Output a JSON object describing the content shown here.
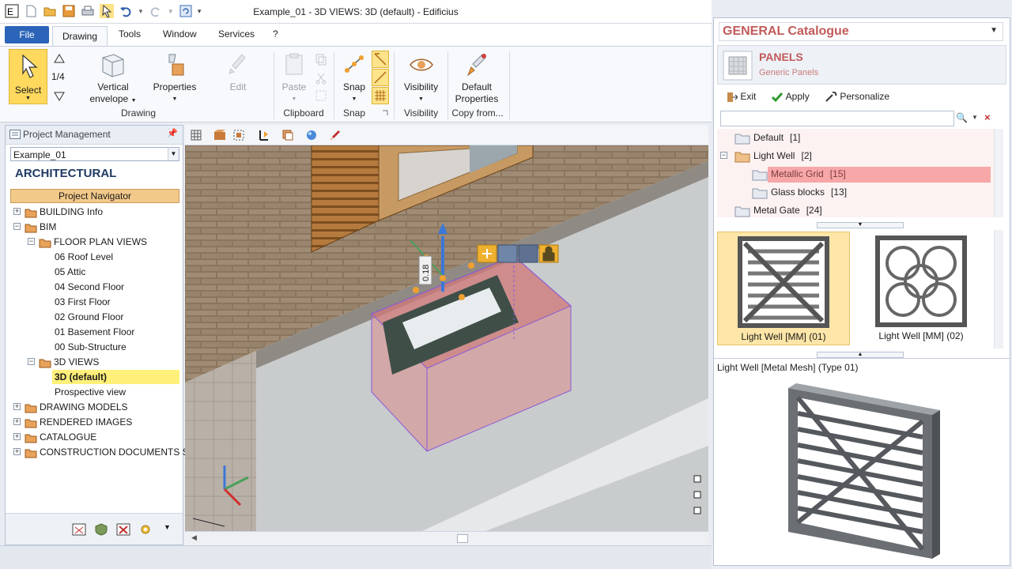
{
  "window": {
    "title": "Example_01 - 3D VIEWS: 3D (default) - Edificius"
  },
  "menu": {
    "file": "File",
    "tabs": [
      "Drawing",
      "Tools",
      "Window",
      "Services",
      "?"
    ]
  },
  "ribbon": {
    "select": "Select",
    "fraction": "1/4",
    "vertical_envelope": [
      "Vertical",
      "envelope"
    ],
    "properties": "Properties",
    "edit": "Edit",
    "paste": "Paste",
    "snap": "Snap",
    "visibility": "Visibility",
    "default_properties": [
      "Default",
      "Properties"
    ],
    "groups": {
      "drawing": "Drawing",
      "clipboard": "Clipboard",
      "snap": "Snap",
      "visibility": "Visibility",
      "copy_from": "Copy from..."
    }
  },
  "left_panel": {
    "header": "Project Management",
    "project": "Example_01",
    "category": "ARCHITECTURAL",
    "navigator": "Project Navigator",
    "tree": [
      {
        "label": "BUILDING Info",
        "level": 0,
        "expander": "+"
      },
      {
        "label": "BIM",
        "level": 0,
        "expander": "−"
      },
      {
        "label": "FLOOR PLAN VIEWS",
        "level": 1,
        "expander": "−"
      },
      {
        "label": "06 Roof Level",
        "level": 2
      },
      {
        "label": "05 Attic",
        "level": 2
      },
      {
        "label": "04 Second Floor",
        "level": 2
      },
      {
        "label": "03 First Floor",
        "level": 2
      },
      {
        "label": "02 Ground Floor",
        "level": 2
      },
      {
        "label": "01 Basement Floor",
        "level": 2
      },
      {
        "label": "00 Sub-Structure",
        "level": 2
      },
      {
        "label": "3D VIEWS",
        "level": 1,
        "expander": "−"
      },
      {
        "label": "3D (default)",
        "level": 2,
        "selected": true
      },
      {
        "label": "Prospective view",
        "level": 2
      },
      {
        "label": "DRAWING MODELS",
        "level": 0,
        "expander": "+"
      },
      {
        "label": "RENDERED IMAGES",
        "level": 0,
        "expander": "+"
      },
      {
        "label": "CATALOGUE",
        "level": 0,
        "expander": "+"
      },
      {
        "label": "CONSTRUCTION DOCUMENTS SET",
        "level": 0,
        "expander": "+"
      }
    ]
  },
  "viewport": {
    "dimension": "0.18"
  },
  "catalogue": {
    "title": "GENERAL Catalogue",
    "section": "PANELS",
    "subsection": "Generic Panels",
    "toolbar": {
      "exit": "Exit",
      "apply": "Apply",
      "personalize": "Personalize"
    },
    "tree": [
      {
        "label": "Default",
        "count": "[1]",
        "level": 0
      },
      {
        "label": "Light Well",
        "count": "[2]",
        "level": 0,
        "expander": "−"
      },
      {
        "label": "Metallic Grid",
        "count": "[15]",
        "level": 1,
        "highlight": true
      },
      {
        "label": "Glass blocks",
        "count": "[13]",
        "level": 1
      },
      {
        "label": "Metal Gate",
        "count": "[24]",
        "level": 0
      }
    ],
    "thumbnails": [
      {
        "label": "Light Well [MM] (01)",
        "selected": true
      },
      {
        "label": "Light Well [MM] (02)"
      }
    ],
    "preview_label": "Light Well [Metal Mesh] (Type 01)"
  }
}
